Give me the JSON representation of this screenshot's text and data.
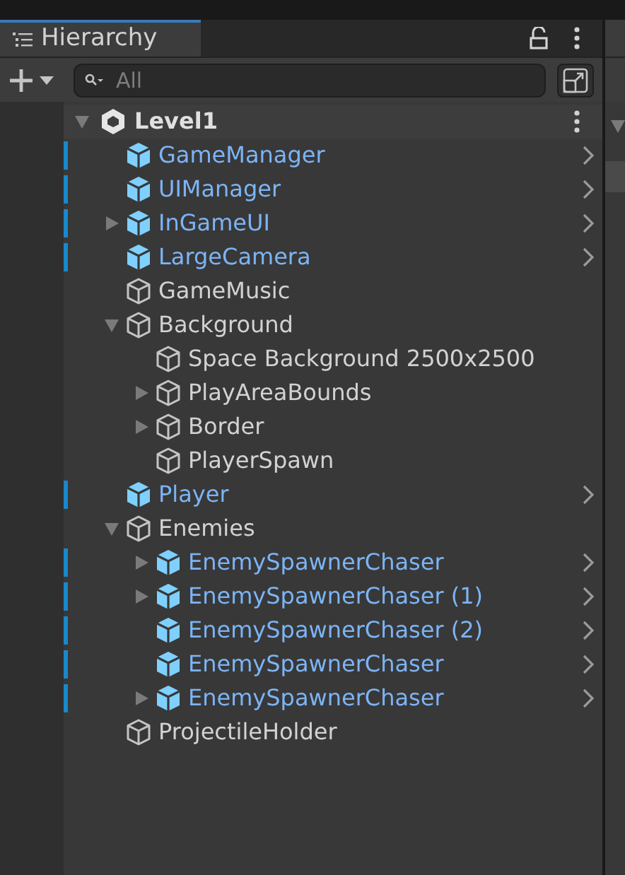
{
  "tab": {
    "title": "Hierarchy",
    "selected": true
  },
  "search": {
    "placeholder": "All"
  },
  "scene": {
    "name": "Level1",
    "expanded": true,
    "children": [
      {
        "name": "GameManager",
        "kind": "prefab"
      },
      {
        "name": "UIManager",
        "kind": "prefab"
      },
      {
        "name": "InGameUI",
        "kind": "prefab",
        "expanded": false
      },
      {
        "name": "LargeCamera",
        "kind": "prefab"
      },
      {
        "name": "GameMusic",
        "kind": "object"
      },
      {
        "name": "Background",
        "kind": "object",
        "expanded": true,
        "children": [
          {
            "name": "Space Background 2500x2500",
            "kind": "object"
          },
          {
            "name": "PlayAreaBounds",
            "kind": "object",
            "expanded": false
          },
          {
            "name": "Border",
            "kind": "object",
            "expanded": false
          },
          {
            "name": "PlayerSpawn",
            "kind": "object"
          }
        ]
      },
      {
        "name": "Player",
        "kind": "prefab"
      },
      {
        "name": "Enemies",
        "kind": "object",
        "expanded": true,
        "children": [
          {
            "name": "EnemySpawnerChaser",
            "kind": "prefab",
            "expanded": false
          },
          {
            "name": "EnemySpawnerChaser (1)",
            "kind": "prefab",
            "expanded": false
          },
          {
            "name": "EnemySpawnerChaser (2)",
            "kind": "prefab"
          },
          {
            "name": "EnemySpawnerChaser",
            "kind": "prefab"
          },
          {
            "name": "EnemySpawnerChaser",
            "kind": "prefab",
            "expanded": false
          }
        ]
      },
      {
        "name": "ProjectileHolder",
        "kind": "object"
      }
    ]
  }
}
